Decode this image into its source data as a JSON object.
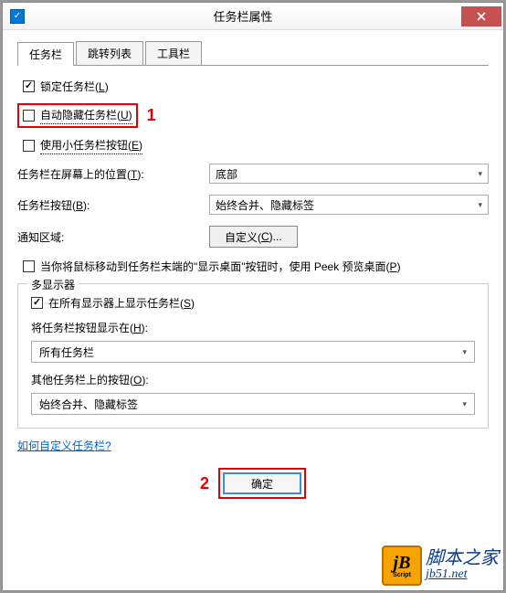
{
  "titlebar": {
    "title": "任务栏属性"
  },
  "tabs": [
    {
      "label": "任务栏",
      "active": true
    },
    {
      "label": "跳转列表",
      "active": false
    },
    {
      "label": "工具栏",
      "active": false
    }
  ],
  "checkboxes": {
    "lock": {
      "text": "锁定任务栏(",
      "key": "L",
      "suffix": ")",
      "checked": true
    },
    "autohide": {
      "text": "自动隐藏任务栏(",
      "key": "U",
      "suffix": ")",
      "checked": false
    },
    "small": {
      "text": "使用小任务栏按钮(",
      "key": "E",
      "suffix": ")",
      "checked": false
    },
    "peek": {
      "prefix": "当你将鼠标移动到任务栏末端的\"显示桌面\"按钮时，使用 Peek 预览桌面(",
      "key": "P",
      "suffix": ")",
      "checked": false
    },
    "allmon": {
      "text": "在所有显示器上显示任务栏(",
      "key": "S",
      "suffix": ")",
      "checked": true
    }
  },
  "fields": {
    "position": {
      "label": "任务栏在屏幕上的位置(",
      "key": "T",
      "suffix": "):",
      "value": "底部"
    },
    "buttons": {
      "label": "任务栏按钮(",
      "key": "B",
      "suffix": "):",
      "value": "始终合并、隐藏标签"
    },
    "notify": {
      "label": "通知区域:",
      "btn_text": "自定义(",
      "btn_key": "C",
      "btn_suffix": ")..."
    }
  },
  "multimon": {
    "legend": "多显示器",
    "showon": {
      "label": "将任务栏按钮显示在(",
      "key": "H",
      "suffix": "):",
      "value": "所有任务栏"
    },
    "other": {
      "label": "其他任务栏上的按钮(",
      "key": "O",
      "suffix": "):",
      "value": "始终合并、隐藏标签"
    }
  },
  "link": "如何自定义任务栏?",
  "footer": {
    "ok": "确定"
  },
  "annotations": {
    "a1": "1",
    "a2": "2"
  },
  "watermark": {
    "logo_j": "jB",
    "logo_s": "Script",
    "text": "脚本之家",
    "url": "jb51.net"
  }
}
